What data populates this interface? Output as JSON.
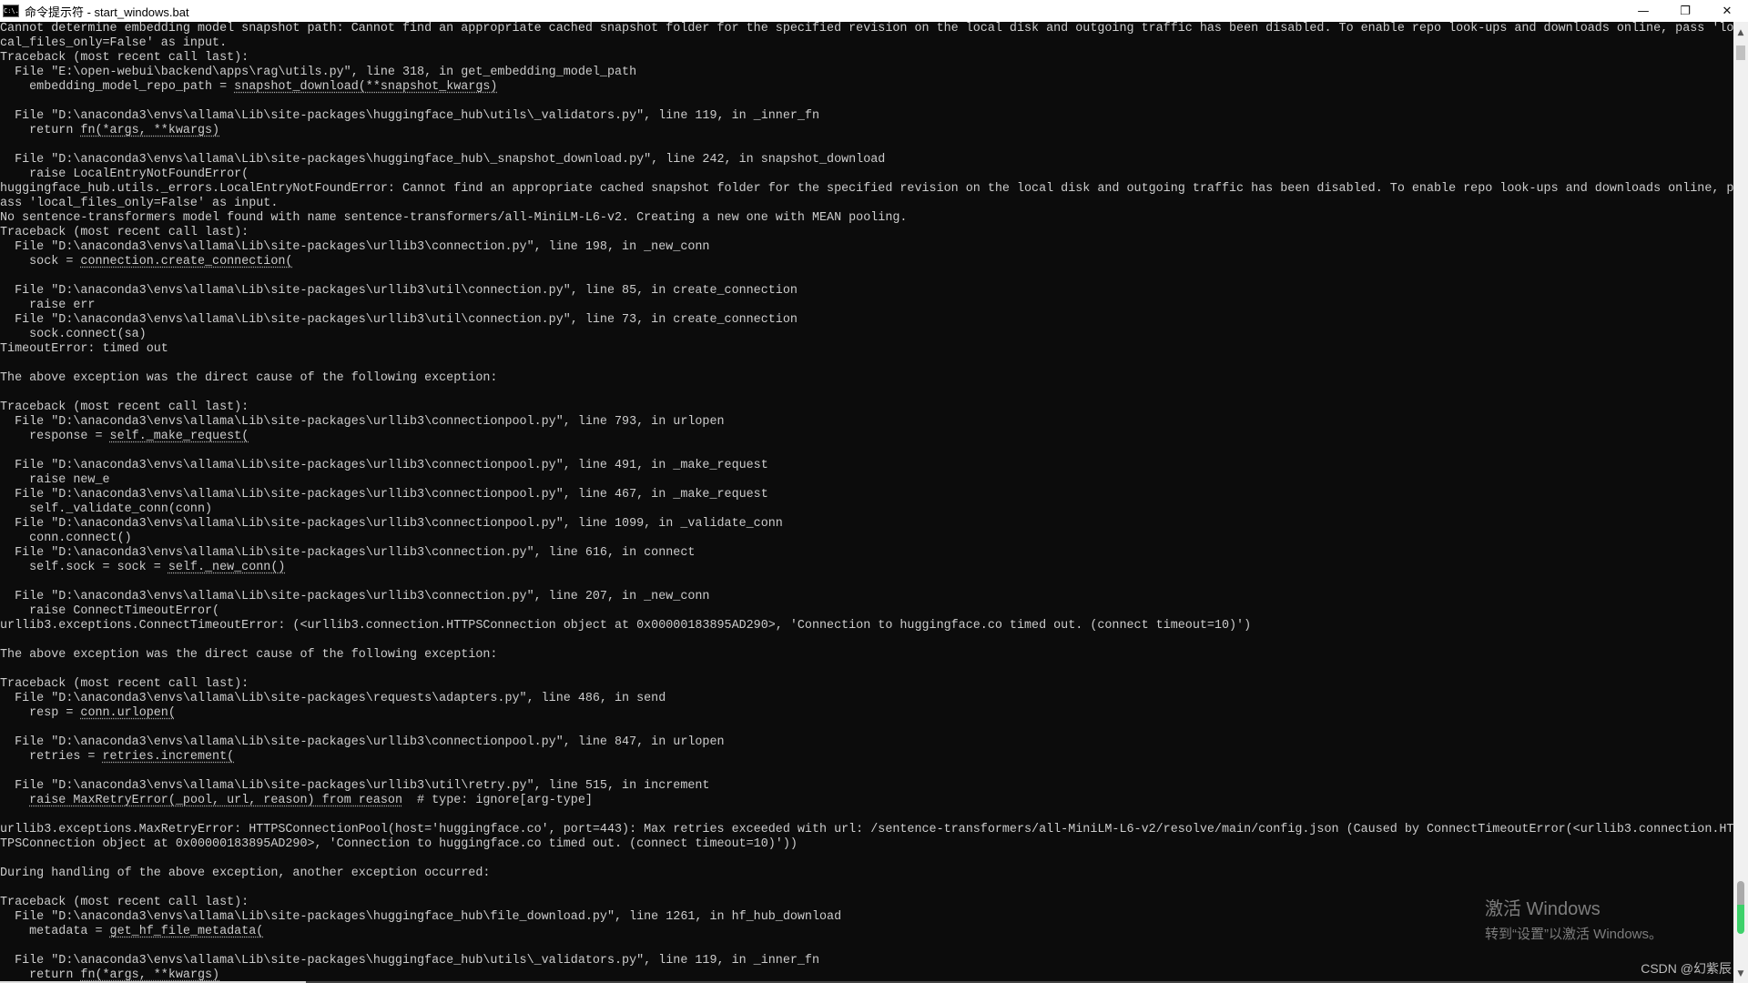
{
  "window": {
    "title": "命令提示符 - start_windows.bat",
    "app_icon_text": "C:\\.",
    "minimize": "—",
    "restore": "❐",
    "close": "✕"
  },
  "scrollbar": {
    "up": "▲",
    "down": "▼"
  },
  "console": {
    "lines": [
      {
        "t": "Cannot determine embedding model snapshot path: Cannot find an appropriate cached snapshot folder for the specified revision on the local disk and outgoing traffic has been disabled. To enable repo look-ups and downloads online, pass 'lo"
      },
      {
        "t": "cal_files_only=False' as input."
      },
      {
        "t": "Traceback (most recent call last):"
      },
      {
        "t": "  File \"E:\\open-webui\\backend\\apps\\rag\\utils.py\", line 318, in get_embedding_model_path"
      },
      {
        "t": "    embedding_model_repo_path = ",
        "u": "snapshot_download(**snapshot_kwargs)"
      },
      {
        "t": ""
      },
      {
        "t": "  File \"D:\\anaconda3\\envs\\allama\\Lib\\site-packages\\huggingface_hub\\utils\\_validators.py\", line 119, in _inner_fn"
      },
      {
        "t": "    return ",
        "u": "fn(*args, **kwargs)"
      },
      {
        "t": ""
      },
      {
        "t": "  File \"D:\\anaconda3\\envs\\allama\\Lib\\site-packages\\huggingface_hub\\_snapshot_download.py\", line 242, in snapshot_download"
      },
      {
        "t": "    raise LocalEntryNotFoundError("
      },
      {
        "t": "huggingface_hub.utils._errors.LocalEntryNotFoundError: Cannot find an appropriate cached snapshot folder for the specified revision on the local disk and outgoing traffic has been disabled. To enable repo look-ups and downloads online, p"
      },
      {
        "t": "ass 'local_files_only=False' as input."
      },
      {
        "t": "No sentence-transformers model found with name sentence-transformers/all-MiniLM-L6-v2. Creating a new one with MEAN pooling."
      },
      {
        "t": "Traceback (most recent call last):"
      },
      {
        "t": "  File \"D:\\anaconda3\\envs\\allama\\Lib\\site-packages\\urllib3\\connection.py\", line 198, in _new_conn"
      },
      {
        "t": "    sock = ",
        "u": "connection.create_connection("
      },
      {
        "t": ""
      },
      {
        "t": "  File \"D:\\anaconda3\\envs\\allama\\Lib\\site-packages\\urllib3\\util\\connection.py\", line 85, in create_connection"
      },
      {
        "t": "    raise err"
      },
      {
        "t": "  File \"D:\\anaconda3\\envs\\allama\\Lib\\site-packages\\urllib3\\util\\connection.py\", line 73, in create_connection"
      },
      {
        "t": "    sock.connect(sa)"
      },
      {
        "t": "TimeoutError: timed out"
      },
      {
        "t": ""
      },
      {
        "t": "The above exception was the direct cause of the following exception:"
      },
      {
        "t": ""
      },
      {
        "t": "Traceback (most recent call last):"
      },
      {
        "t": "  File \"D:\\anaconda3\\envs\\allama\\Lib\\site-packages\\urllib3\\connectionpool.py\", line 793, in urlopen"
      },
      {
        "t": "    response = ",
        "u": "self._make_request("
      },
      {
        "t": ""
      },
      {
        "t": "  File \"D:\\anaconda3\\envs\\allama\\Lib\\site-packages\\urllib3\\connectionpool.py\", line 491, in _make_request"
      },
      {
        "t": "    raise new_e"
      },
      {
        "t": "  File \"D:\\anaconda3\\envs\\allama\\Lib\\site-packages\\urllib3\\connectionpool.py\", line 467, in _make_request"
      },
      {
        "t": "    self._validate_conn(conn)"
      },
      {
        "t": "  File \"D:\\anaconda3\\envs\\allama\\Lib\\site-packages\\urllib3\\connectionpool.py\", line 1099, in _validate_conn"
      },
      {
        "t": "    conn.connect()"
      },
      {
        "t": "  File \"D:\\anaconda3\\envs\\allama\\Lib\\site-packages\\urllib3\\connection.py\", line 616, in connect"
      },
      {
        "t": "    self.sock = sock = ",
        "u": "self._new_conn()"
      },
      {
        "t": ""
      },
      {
        "t": "  File \"D:\\anaconda3\\envs\\allama\\Lib\\site-packages\\urllib3\\connection.py\", line 207, in _new_conn"
      },
      {
        "t": "    raise ConnectTimeoutError("
      },
      {
        "t": "urllib3.exceptions.ConnectTimeoutError: (<urllib3.connection.HTTPSConnection object at 0x00000183895AD290>, 'Connection to huggingface.co timed out. (connect timeout=10)')"
      },
      {
        "t": ""
      },
      {
        "t": "The above exception was the direct cause of the following exception:"
      },
      {
        "t": ""
      },
      {
        "t": "Traceback (most recent call last):"
      },
      {
        "t": "  File \"D:\\anaconda3\\envs\\allama\\Lib\\site-packages\\requests\\adapters.py\", line 486, in send"
      },
      {
        "t": "    resp = ",
        "u": "conn.urlopen("
      },
      {
        "t": ""
      },
      {
        "t": "  File \"D:\\anaconda3\\envs\\allama\\Lib\\site-packages\\urllib3\\connectionpool.py\", line 847, in urlopen"
      },
      {
        "t": "    retries = ",
        "u": "retries.increment("
      },
      {
        "t": ""
      },
      {
        "t": "  File \"D:\\anaconda3\\envs\\allama\\Lib\\site-packages\\urllib3\\util\\retry.py\", line 515, in increment"
      },
      {
        "t": "    ",
        "u": "raise MaxRetryError(_pool, url, reason) from reason",
        "a": "  # type: ignore[arg-type]"
      },
      {
        "t": ""
      },
      {
        "t": "urllib3.exceptions.MaxRetryError: HTTPSConnectionPool(host='huggingface.co', port=443): Max retries exceeded with url: /sentence-transformers/all-MiniLM-L6-v2/resolve/main/config.json (Caused by ConnectTimeoutError(<urllib3.connection.HT"
      },
      {
        "t": "TPSConnection object at 0x00000183895AD290>, 'Connection to huggingface.co timed out. (connect timeout=10)'))"
      },
      {
        "t": ""
      },
      {
        "t": "During handling of the above exception, another exception occurred:"
      },
      {
        "t": ""
      },
      {
        "t": "Traceback (most recent call last):"
      },
      {
        "t": "  File \"D:\\anaconda3\\envs\\allama\\Lib\\site-packages\\huggingface_hub\\file_download.py\", line 1261, in hf_hub_download"
      },
      {
        "t": "    metadata = ",
        "u": "get_hf_file_metadata("
      },
      {
        "t": ""
      },
      {
        "t": "  File \"D:\\anaconda3\\envs\\allama\\Lib\\site-packages\\huggingface_hub\\utils\\_validators.py\", line 119, in _inner_fn"
      },
      {
        "t": "    return ",
        "u": "fn(*args, **kwargs)"
      }
    ]
  },
  "watermark": {
    "title": "激活 Windows",
    "subtitle": "转到“设置”以激活 Windows。"
  },
  "credit": "CSDN @幻紫辰"
}
